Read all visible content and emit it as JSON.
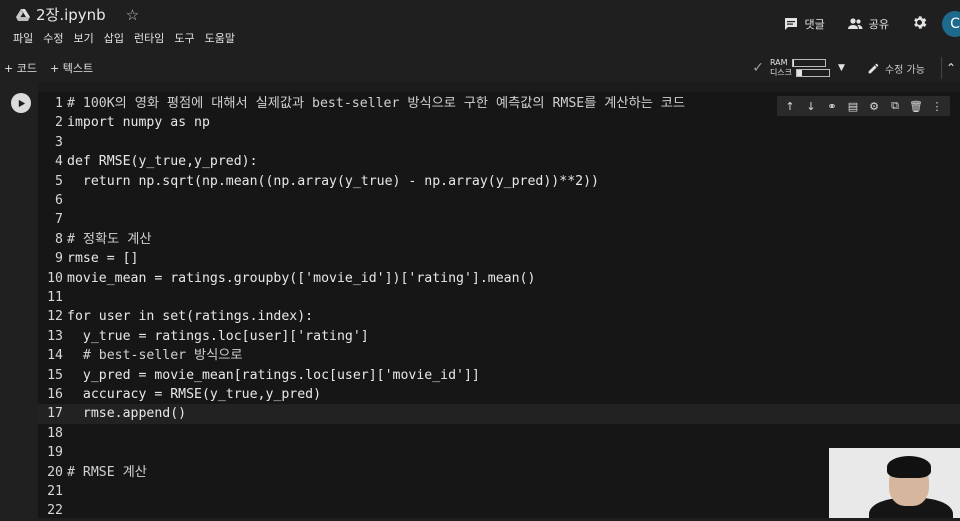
{
  "header": {
    "file_title": "2장.ipynb",
    "menu": [
      "파일",
      "수정",
      "보기",
      "삽입",
      "런타임",
      "도구",
      "도움말"
    ],
    "comment_label": "댓글",
    "share_label": "공유",
    "avatar_letter": "C"
  },
  "toolbar": {
    "add_code": "+ 코드",
    "add_text": "+ 텍스트",
    "ram_label": "RAM",
    "disk_label": "디스크",
    "ram_usage": 0.05,
    "disk_usage": 0.15,
    "edit_label": "수정 가능"
  },
  "cell": {
    "lines": [
      {
        "n": "1",
        "text": "# 100K의 영화 평점에 대해서 실제값과 best-seller 방식으로 구한 예측값의 RMSE를 계산하는 코드"
      },
      {
        "n": "2",
        "text": "import numpy as np"
      },
      {
        "n": "3",
        "text": ""
      },
      {
        "n": "4",
        "text": "def RMSE(y_true,y_pred):"
      },
      {
        "n": "5",
        "text": "  return np.sqrt(np.mean((np.array(y_true) - np.array(y_pred))**2))"
      },
      {
        "n": "6",
        "text": ""
      },
      {
        "n": "7",
        "text": ""
      },
      {
        "n": "8",
        "text": "# 정확도 계산"
      },
      {
        "n": "9",
        "text": "rmse = []"
      },
      {
        "n": "10",
        "text": "movie_mean = ratings.groupby(['movie_id'])['rating'].mean()"
      },
      {
        "n": "11",
        "text": ""
      },
      {
        "n": "12",
        "text": "for user in set(ratings.index):"
      },
      {
        "n": "13",
        "text": "  y_true = ratings.loc[user]['rating']"
      },
      {
        "n": "14",
        "text": "  # best-seller 방식으로"
      },
      {
        "n": "15",
        "text": "  y_pred = movie_mean[ratings.loc[user]['movie_id']]"
      },
      {
        "n": "16",
        "text": "  accuracy = RMSE(y_true,y_pred)"
      },
      {
        "n": "17",
        "text": "  rmse.append()"
      },
      {
        "n": "18",
        "text": ""
      },
      {
        "n": "19",
        "text": ""
      },
      {
        "n": "20",
        "text": "# RMSE 계산"
      },
      {
        "n": "21",
        "text": ""
      },
      {
        "n": "22",
        "text": ""
      }
    ],
    "active_line": 17
  },
  "colors": {
    "background": "#1f1f1f",
    "editor": "#161616",
    "avatar": "#1e6a8c"
  }
}
